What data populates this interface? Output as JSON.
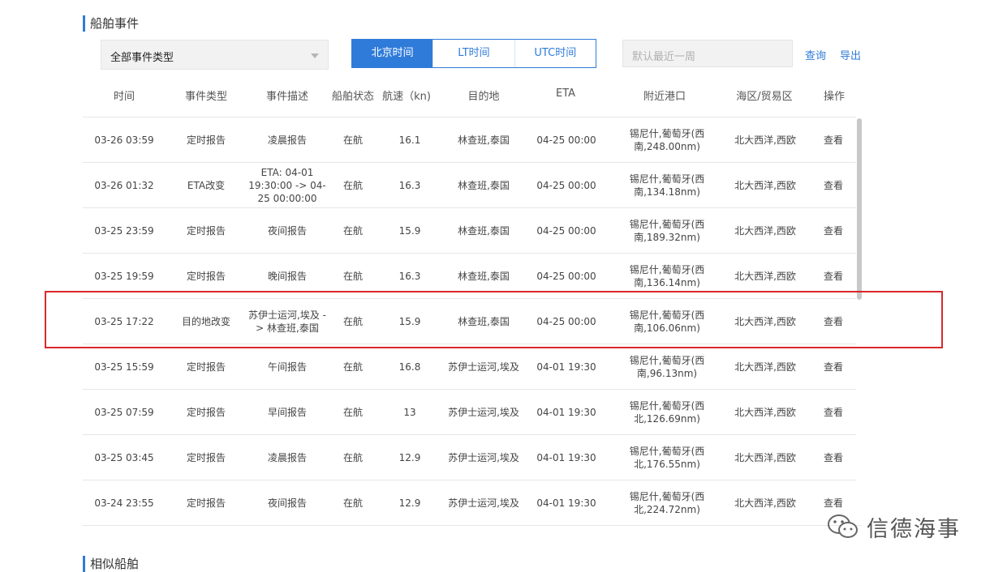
{
  "events_section": {
    "title": "船舶事件",
    "event_type_select": "全部事件类型",
    "time_tabs": [
      {
        "label": "北京时间",
        "active": true
      },
      {
        "label": "LT时间",
        "active": false
      },
      {
        "label": "UTC时间",
        "active": false
      }
    ],
    "date_placeholder": "默认最近一周",
    "query_label": "查询",
    "export_label": "导出"
  },
  "table": {
    "headers": [
      "时间",
      "事件类型",
      "事件描述",
      "船舶状态",
      "航速（kn)",
      "目的地",
      "ETA",
      "附近港口",
      "海区/贸易区",
      "操作"
    ],
    "rows": [
      {
        "time": "03-26 03:59",
        "type": "定时报告",
        "desc": "凌晨报告",
        "status": "在航",
        "speed": "16.1",
        "dest": "林查班,泰国",
        "eta": "04-25 00:00",
        "port_line1": "锡尼什,葡萄牙(西",
        "port_line2": "南,248.00nm)",
        "area": "北大西洋,西欧",
        "action": "查看"
      },
      {
        "time": "03-26 01:32",
        "type": "ETA改变",
        "desc": "ETA: 04-01\n19:30:00 -> 04-\n25 00:00:00",
        "status": "在航",
        "speed": "16.3",
        "dest": "林查班,泰国",
        "eta": "04-25 00:00",
        "port_line1": "锡尼什,葡萄牙(西",
        "port_line2": "南,134.18nm)",
        "area": "北大西洋,西欧",
        "action": "查看"
      },
      {
        "time": "03-25 23:59",
        "type": "定时报告",
        "desc": "夜间报告",
        "status": "在航",
        "speed": "15.9",
        "dest": "林查班,泰国",
        "eta": "04-25 00:00",
        "port_line1": "锡尼什,葡萄牙(西",
        "port_line2": "南,189.32nm)",
        "area": "北大西洋,西欧",
        "action": "查看"
      },
      {
        "time": "03-25 19:59",
        "type": "定时报告",
        "desc": "晚间报告",
        "status": "在航",
        "speed": "16.3",
        "dest": "林查班,泰国",
        "eta": "04-25 00:00",
        "port_line1": "锡尼什,葡萄牙(西",
        "port_line2": "南,136.14nm)",
        "area": "北大西洋,西欧",
        "action": "查看"
      },
      {
        "time": "03-25 17:22",
        "type": "目的地改变",
        "desc": "苏伊士运河,埃及 -\n> 林查班,泰国",
        "status": "在航",
        "speed": "15.9",
        "dest": "林查班,泰国",
        "eta": "04-25 00:00",
        "port_line1": "锡尼什,葡萄牙(西",
        "port_line2": "南,106.06nm)",
        "area": "北大西洋,西欧",
        "action": "查看"
      },
      {
        "time": "03-25 15:59",
        "type": "定时报告",
        "desc": "午间报告",
        "status": "在航",
        "speed": "16.8",
        "dest": "苏伊士运河,埃及",
        "eta": "04-01 19:30",
        "port_line1": "锡尼什,葡萄牙(西",
        "port_line2": "南,96.13nm)",
        "area": "北大西洋,西欧",
        "action": "查看"
      },
      {
        "time": "03-25 07:59",
        "type": "定时报告",
        "desc": "早间报告",
        "status": "在航",
        "speed": "13",
        "dest": "苏伊士运河,埃及",
        "eta": "04-01 19:30",
        "port_line1": "锡尼什,葡萄牙(西",
        "port_line2": "北,126.69nm)",
        "area": "北大西洋,西欧",
        "action": "查看"
      },
      {
        "time": "03-25 03:45",
        "type": "定时报告",
        "desc": "凌晨报告",
        "status": "在航",
        "speed": "12.9",
        "dest": "苏伊士运河,埃及",
        "eta": "04-01 19:30",
        "port_line1": "锡尼什,葡萄牙(西",
        "port_line2": "北,176.55nm)",
        "area": "北大西洋,西欧",
        "action": "查看"
      },
      {
        "time": "03-24 23:55",
        "type": "定时报告",
        "desc": "夜间报告",
        "status": "在航",
        "speed": "12.9",
        "dest": "苏伊士运河,埃及",
        "eta": "04-01 19:30",
        "port_line1": "锡尼什,葡萄牙(西",
        "port_line2": "北,224.72nm)",
        "area": "北大西洋,西欧",
        "action": "查看"
      }
    ]
  },
  "similar_section": {
    "title": "相似船舶"
  },
  "watermark": {
    "text": "信德海事",
    "icon": "wechat-icon"
  },
  "colors": {
    "accent": "#2f7bd9",
    "highlight": "#d9282b"
  }
}
